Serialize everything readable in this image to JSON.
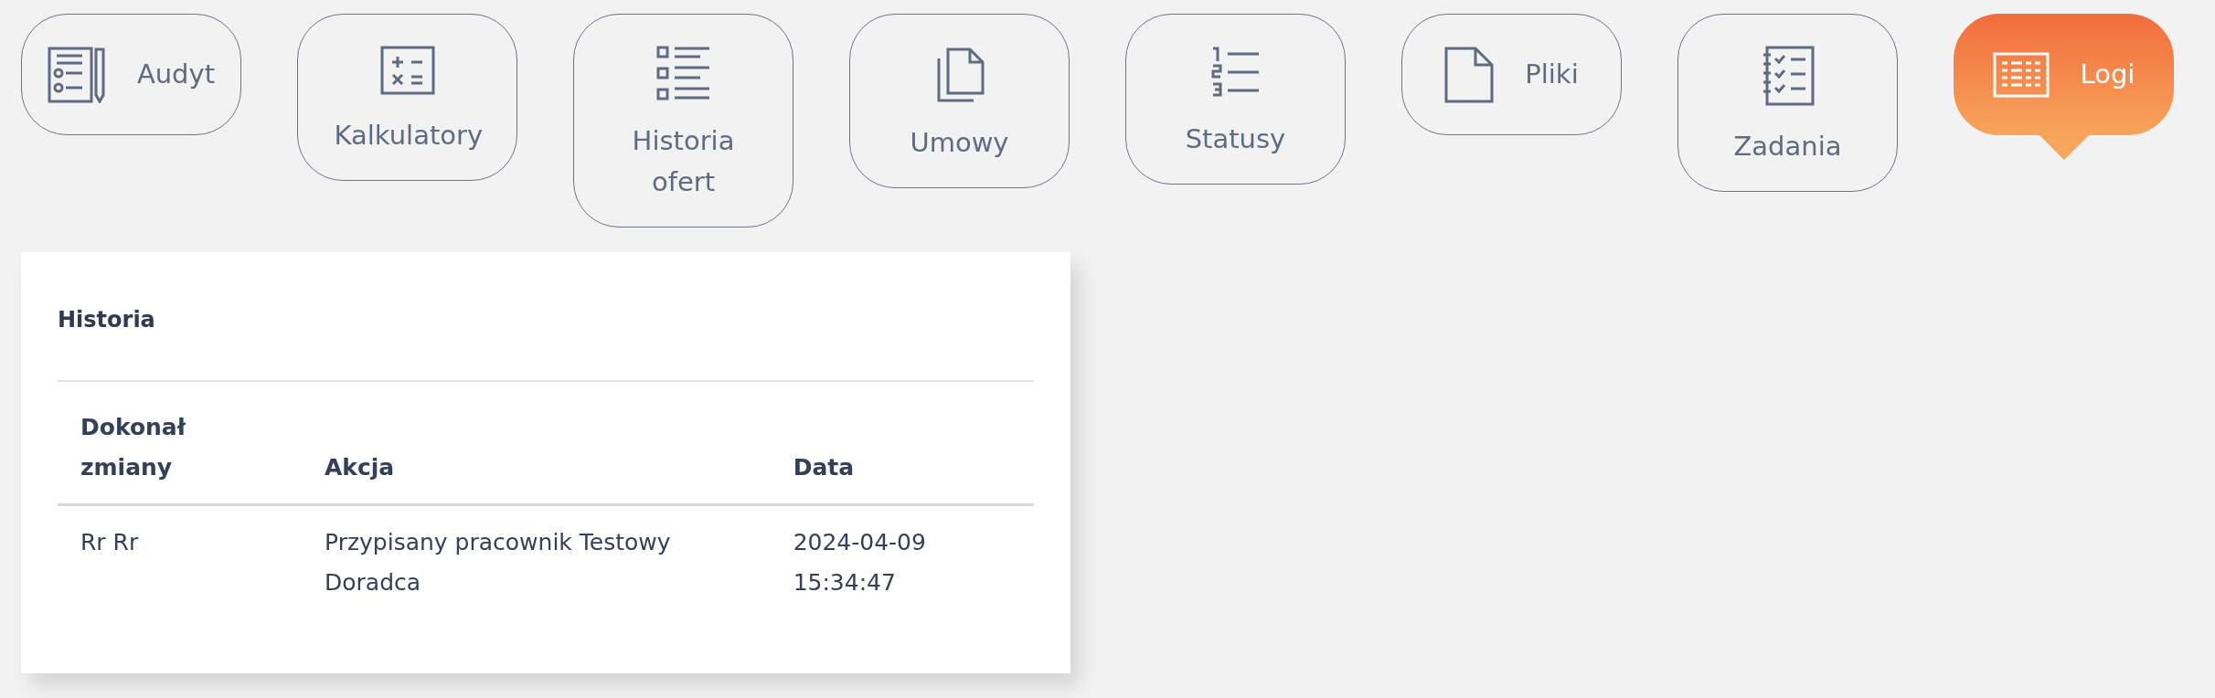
{
  "buttons": [
    {
      "label": "Audyt",
      "selected": false
    },
    {
      "label": "Kalkulatory",
      "selected": false
    },
    {
      "label": "Historia ofert",
      "selected": false
    },
    {
      "label": "Umowy",
      "selected": false
    },
    {
      "label": "Statusy",
      "selected": false
    },
    {
      "label": "Pliki",
      "selected": false
    },
    {
      "label": "Zadania",
      "selected": false
    },
    {
      "label": "Logi",
      "selected": true
    }
  ],
  "history": {
    "title": "Historia",
    "columns": [
      "Dokonał zmiany",
      "Akcja",
      "Data"
    ],
    "rows": [
      [
        "Rr Rr",
        "Przypisany pracownik Testowy Doradca",
        "2024-04-09 15:34:47"
      ]
    ]
  }
}
